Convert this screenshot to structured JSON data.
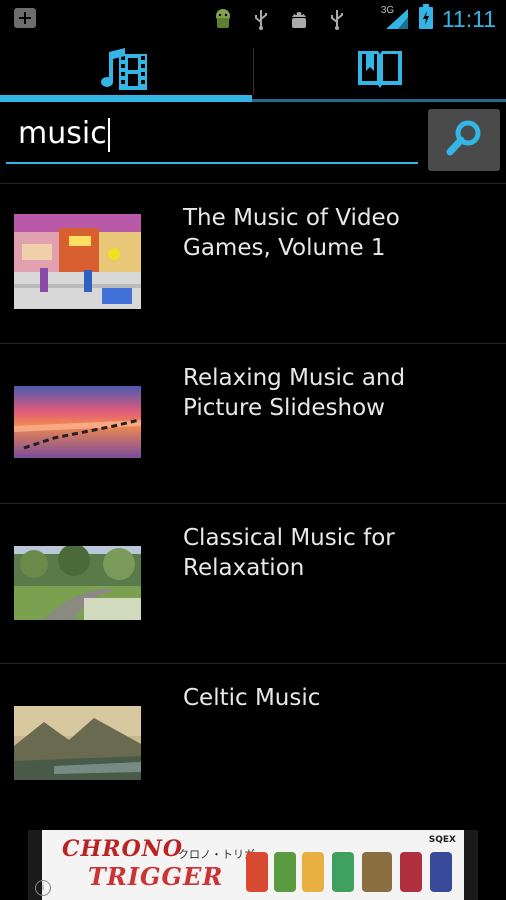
{
  "status_bar": {
    "network": "3G",
    "time": "11:11",
    "icons": [
      "add-icon",
      "android-icon",
      "usb-icon",
      "android-debug-icon",
      "usb-icon",
      "signal-icon",
      "battery-charging-icon"
    ]
  },
  "tabs": [
    {
      "name": "music-tab",
      "icon": "music-film-icon",
      "selected": true
    },
    {
      "name": "book-tab",
      "icon": "bookmark-book-icon",
      "selected": false
    }
  ],
  "search": {
    "value": "music",
    "button_icon": "search-icon"
  },
  "results": [
    {
      "title": "The Music of Video Games, Volume 1",
      "thumbnail": "video-game-street-scene"
    },
    {
      "title": "Relaxing Music and Picture Slideshow",
      "thumbnail": "sunset-lake"
    },
    {
      "title": "Classical Music for Relaxation",
      "thumbnail": "garden-path-flowers"
    },
    {
      "title": "Celtic Music",
      "thumbnail": "fantasy-landscape"
    }
  ],
  "ad": {
    "logo_line1": "CHRONO",
    "logo_line2": "TRIGGER",
    "subtitle_jp": "クロノ・トリガー",
    "brand": "SQEX",
    "info": "i"
  },
  "colors": {
    "accent": "#33b5e5",
    "background": "#000000",
    "search_button": "#4a4a4a"
  }
}
